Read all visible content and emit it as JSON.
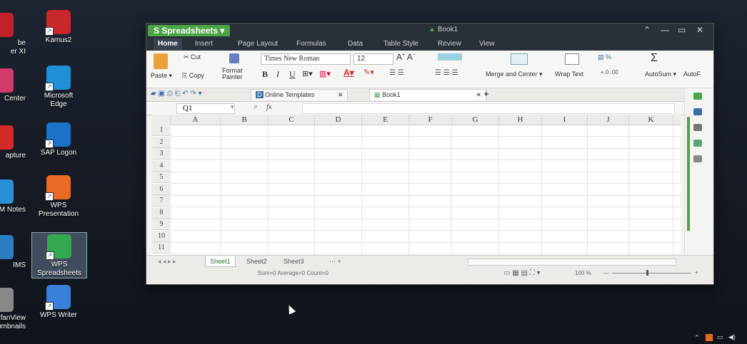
{
  "desktop": {
    "left_partial": [
      {
        "label": "be\ner XI",
        "color": "#c0212a"
      },
      {
        "label": "Center",
        "color": "#d13a6a"
      },
      {
        "label": "apture",
        "color": "#d42a2a"
      },
      {
        "label": "M Notes",
        "color": "#2a8fd6"
      },
      {
        "label": "IMS",
        "color": "#2a7ec0"
      },
      {
        "label": "ufanView\nhumbnails",
        "color": "#888888"
      }
    ],
    "icons": [
      {
        "label": "Kamus2",
        "color": "#c8282a",
        "icon": "book-icon"
      },
      {
        "label": "Microsoft\nEdge",
        "color": "#1f8fd8",
        "icon": "edge-icon"
      },
      {
        "label": "SAP Logon",
        "color": "#1a73c9",
        "icon": "sap-icon"
      },
      {
        "label": "WPS\nPresentation",
        "color": "#e86a25",
        "icon": "wps-presentation-icon"
      },
      {
        "label": "WPS\nSpreadsheets",
        "color": "#35a852",
        "icon": "wps-spreadsheets-icon"
      },
      {
        "label": "WPS Writer",
        "color": "#3a80d8",
        "icon": "wps-writer-icon"
      }
    ]
  },
  "window": {
    "app_name": "Spreadsheets",
    "doc_title": "Book1",
    "menu": [
      "Home",
      "Insert",
      "Page Layout",
      "Formulas",
      "Data",
      "Table Style",
      "Review",
      "View"
    ],
    "ribbon": {
      "paste": "Paste",
      "cut": "Cut",
      "copy": "Copy",
      "format_painter": "Format\nPainter",
      "font_name": "Times New Roman",
      "font_size": "12",
      "bold": "B",
      "italic": "I",
      "underline": "U",
      "merge": "Merge and Center",
      "wrap": "Wrap Text",
      "autosum": "AutoSum",
      "autofill": "AutoF"
    },
    "tabs": {
      "online_templates": "Online Templates",
      "book": "Book1"
    },
    "formula": {
      "name_box": "Q1",
      "fx": "fx"
    },
    "columns": [
      "A",
      "B",
      "C",
      "D",
      "E",
      "F",
      "G",
      "H",
      "I",
      "J",
      "K"
    ],
    "rows": [
      "1",
      "2",
      "3",
      "4",
      "5",
      "6",
      "7",
      "8",
      "9",
      "10",
      "11"
    ],
    "sheets": [
      "Sheet1",
      "Sheet2",
      "Sheet3"
    ],
    "sheet_more": "···  +",
    "status": "Sum=0  Average=0  Count=0",
    "zoom": "100 %"
  },
  "colors": {
    "accent_green": "#4aa644",
    "titlebar": "#2a3038"
  }
}
